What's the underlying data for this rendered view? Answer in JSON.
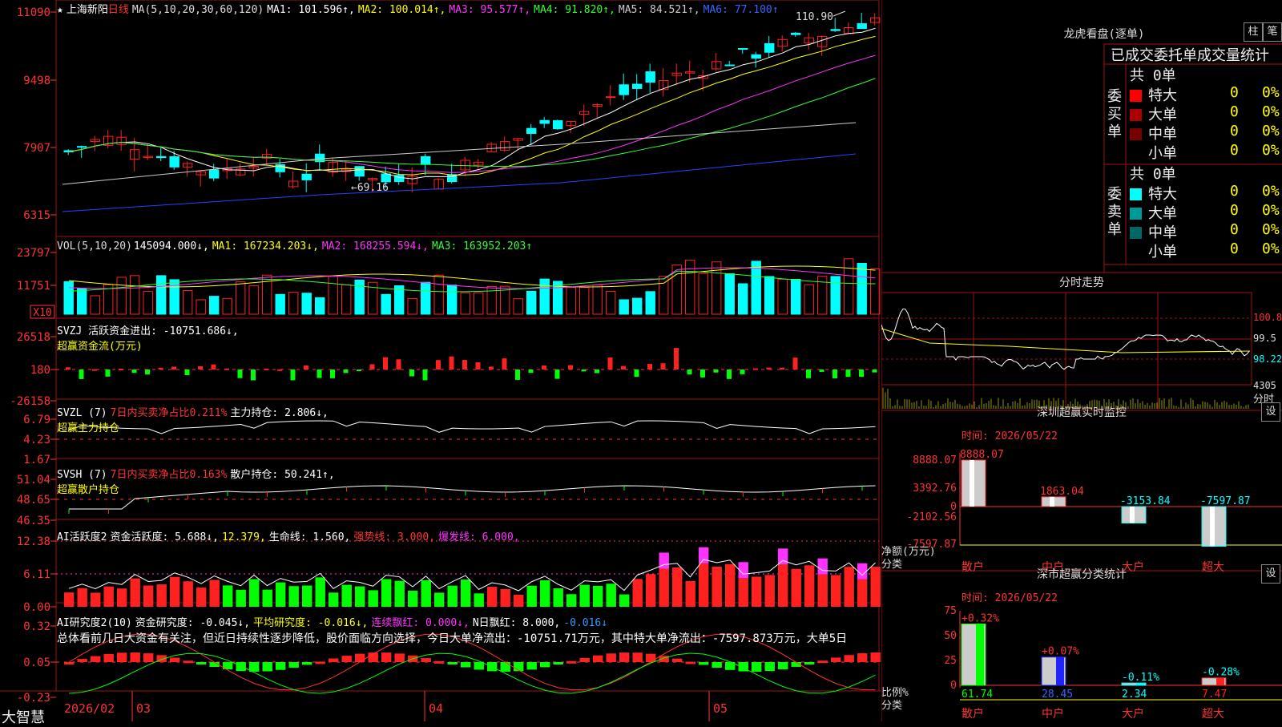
{
  "stock": {
    "name": "上海新阳",
    "period": "日线",
    "star": "★"
  },
  "ma_header": {
    "label": "MA(5,10,20,30,60,120)",
    "items": [
      {
        "text": "MA1: 101.596↑,",
        "color": "#ffffff"
      },
      {
        "text": "MA2: 100.014↑,",
        "color": "#ffff00"
      },
      {
        "text": "MA3: 95.577↑,",
        "color": "#ff33ff"
      },
      {
        "text": "MA4: 91.820↑,",
        "color": "#33ff33"
      },
      {
        "text": "MA5: 84.521↑,",
        "color": "#cccccc"
      },
      {
        "text": "MA6: 77.100↑",
        "color": "#3366ff"
      }
    ]
  },
  "price_axis": [
    "11090",
    "9498",
    "7907",
    "6315"
  ],
  "price_annotations": {
    "high": "110.90",
    "low": "69.16"
  },
  "vol_header": {
    "label": "VOL(5,10,20)",
    "value": "145094.000↓,",
    "items": [
      {
        "text": "MA1: 167234.203↓,",
        "color": "#ffff00"
      },
      {
        "text": "MA2: 168255.594↓,",
        "color": "#ff33ff"
      },
      {
        "text": "MA3: 163952.203↑",
        "color": "#33ff33"
      }
    ]
  },
  "vol_axis": [
    "23797",
    "11751"
  ],
  "vol_unit": "X10",
  "svzj": {
    "line1": "SVZJ  活跃资金进出: -10751.686↓,",
    "line2": "超赢资金流(万元)",
    "axis": [
      "26518",
      "180",
      "-26158"
    ]
  },
  "svzl": {
    "name": "SVZL (7)",
    "t1": "7日内买卖净占比0.211%",
    "t2": "主力持仓: 2.806↓,",
    "line2": "超赢主力持仓",
    "axis": [
      "6.79",
      "4.23",
      "1.67"
    ]
  },
  "svsh": {
    "name": "SVSH (7)",
    "t1": "7日内买卖净占比0.163%",
    "t2": "散户持仓: 50.241↑,",
    "line2": "超赢散户持仓",
    "axis": [
      "51.04",
      "48.65",
      "46.35"
    ]
  },
  "ai1": {
    "name": "AI活跃度2",
    "t1": "资金活跃度: 5.688↓,",
    "t2": "12.379,",
    "t3": "生命线: 1.560,",
    "t4": "强势线: 3.000,",
    "t5": "爆发线: 6.000,",
    "axis": [
      "12.38",
      "6.11",
      "0.00"
    ]
  },
  "ai2": {
    "name": "AI研究度2(10)",
    "t1": "资金研究度: -0.045↓,",
    "t2": "平均研究度: -0.016↓,",
    "t3": "连续飘红: 0.000↓,",
    "t4": "N日飘红: 8.000,",
    "t5": "-0.016↓",
    "axis": [
      "0.32",
      "0.05",
      "-0.23"
    ]
  },
  "commentary": "总体看前几日大资金有关注，但近日持续性逐步降低，股价面临方向选择，今日大单净流出：-10751.71万元，其中特大单净流出：-7597.873万元，大单5日",
  "date_axis": [
    "2026/02",
    "03",
    "04",
    "05"
  ],
  "brand": "大智慧",
  "lhb": {
    "title": "龙虎看盘(逐单)",
    "btn1": "柱",
    "btn2": "笔",
    "tabs": "已成交委托单成交量统计",
    "buy_side": "委买单",
    "sell_side": "委卖单",
    "buy_total": "共 0单",
    "sell_total": "共 0单",
    "buy_rows": [
      {
        "label": "特大",
        "count": "0",
        "pct": "0%",
        "color": "#ff0000"
      },
      {
        "label": "大单",
        "count": "0",
        "pct": "0%",
        "color": "#aa0000"
      },
      {
        "label": "中单",
        "count": "0",
        "pct": "0%",
        "color": "#770000"
      },
      {
        "label": "小单",
        "count": "0",
        "pct": "0%",
        "color": "#000000"
      }
    ],
    "sell_rows": [
      {
        "label": "特大",
        "count": "0",
        "pct": "0%",
        "color": "#00ffff"
      },
      {
        "label": "大单",
        "count": "0",
        "pct": "0%",
        "color": "#009999"
      },
      {
        "label": "中单",
        "count": "0",
        "pct": "0%",
        "color": "#006666"
      },
      {
        "label": "小单",
        "count": "0",
        "pct": "0%",
        "color": "#000000"
      }
    ]
  },
  "fenshi": {
    "title": "分时走势",
    "axis": [
      "100.8",
      "99.5",
      "98.22"
    ],
    "vol": "4305",
    "unit": "分时"
  },
  "sz_monitor": {
    "title": "深圳超赢实时监控",
    "btn": "设",
    "time": "时间: 2026/05/22",
    "axis": [
      "8888.07",
      "3392.76",
      "0",
      "-2102.56",
      "-7597.87"
    ],
    "yunit": "净额(万元)",
    "xunit": "分类",
    "bars": [
      {
        "cat": "散户",
        "value": 8888.07,
        "label": "8888.07"
      },
      {
        "cat": "中户",
        "value": 1863.04,
        "label": "1863.04"
      },
      {
        "cat": "大户",
        "value": -3153.84,
        "label": "-3153.84"
      },
      {
        "cat": "超大",
        "value": -7597.87,
        "label": "-7597.87"
      }
    ]
  },
  "sz_stats": {
    "title": "深市超赢分类统计",
    "btn": "设",
    "time": "时间: 2026/05/22",
    "axis": [
      "75",
      "50",
      "25",
      "0"
    ],
    "yunit": "比例%",
    "xunit": "分类",
    "bars": [
      {
        "cat": "散户",
        "value": 61.74,
        "label": "61.74",
        "delta": "+0.32%"
      },
      {
        "cat": "中户",
        "value": 28.45,
        "label": "28.45",
        "delta": "+0.07%"
      },
      {
        "cat": "大户",
        "value": 2.34,
        "label": "2.34",
        "delta": "-0.11%"
      },
      {
        "cat": "超大",
        "value": 7.47,
        "label": "7.47",
        "delta": "-0.28%"
      }
    ]
  },
  "colors": {
    "up": "#ff2020",
    "down": "#00ffff",
    "grid": "#a01010",
    "magenta": "#ff33ff",
    "green": "#00ff00",
    "yellow": "#ffff00"
  }
}
